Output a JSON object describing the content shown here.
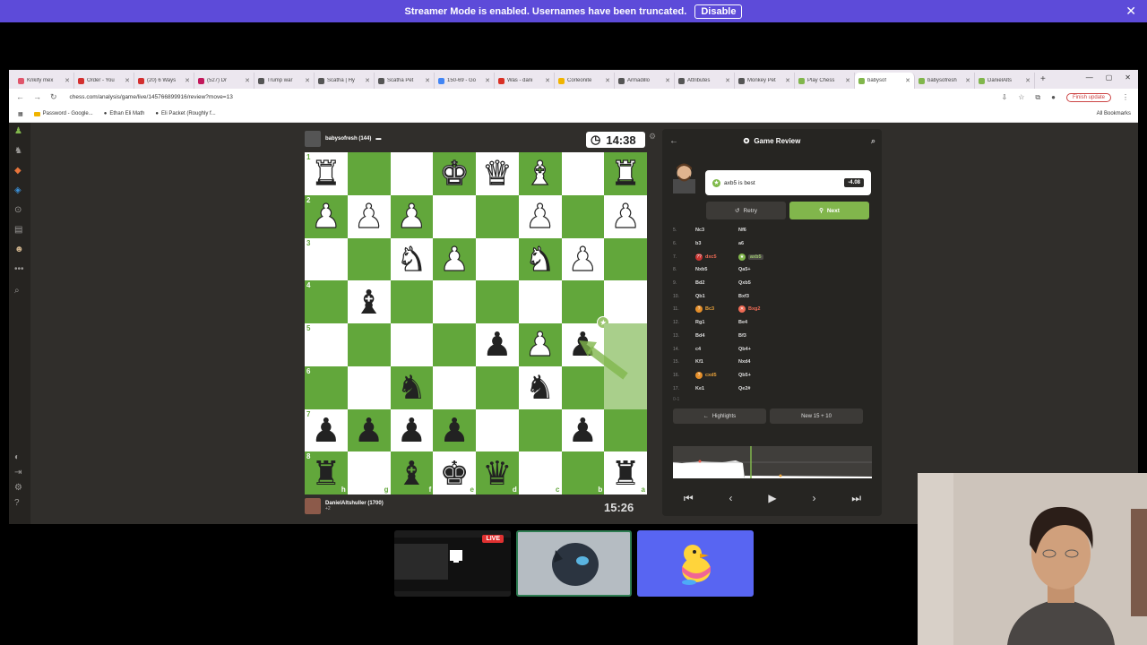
{
  "banner": {
    "message": "Streamer Mode is enabled. Usernames have been truncated.",
    "button": "Disable"
  },
  "browser": {
    "tabs": [
      {
        "label": "Krikify mex",
        "color": "#e0556b"
      },
      {
        "label": "Order - You",
        "color": "#d32f2f"
      },
      {
        "label": "(20) 6 Ways",
        "color": "#d32f2f"
      },
      {
        "label": "(527) Dr",
        "color": "#c2185b"
      },
      {
        "label": "Trump war",
        "color": "#555555"
      },
      {
        "label": "Scatha | Hy",
        "color": "#555555"
      },
      {
        "label": "Scatha Pet",
        "color": "#555555"
      },
      {
        "label": "150-69 - Go",
        "color": "#4285f4"
      },
      {
        "label": "Was - dani",
        "color": "#d93025"
      },
      {
        "label": "Corleonite",
        "color": "#f0b400"
      },
      {
        "label": "Armadillo",
        "color": "#555555"
      },
      {
        "label": "Attributes",
        "color": "#555555"
      },
      {
        "label": "Monkey Pet",
        "color": "#555555"
      },
      {
        "label": "Play Chess",
        "color": "#81b64c"
      },
      {
        "label": "babysof",
        "color": "#81b64c"
      },
      {
        "label": "babysofresh",
        "color": "#81b64c"
      },
      {
        "label": "DanielAlts",
        "color": "#81b64c"
      }
    ],
    "url": "chess.com/analysis/game/live/145766899916/review?move=13",
    "finish_update": "Finish update",
    "bookmarks": [
      "Password - Google...",
      "Ethan Eli Math",
      "Eli Packet (Roughly f..."
    ],
    "all_bookmarks": "All Bookmarks"
  },
  "game": {
    "top_player": "babysofresh (144)",
    "top_clock": "14:38",
    "bottom_player": "DanielAltshuller (1700)",
    "bottom_sub": "+2",
    "bottom_clock": "15:26",
    "board": [
      [
        "wR",
        "",
        "",
        "wK",
        "wQ",
        "wB",
        "",
        "wR"
      ],
      [
        "wP",
        "wP",
        "wP",
        "",
        "",
        "wP",
        "",
        "wP"
      ],
      [
        "",
        "",
        "wN",
        "wP",
        "",
        "wN",
        "wP",
        ""
      ],
      [
        "",
        "bB",
        "",
        "",
        "",
        "",
        "",
        ""
      ],
      [
        "",
        "",
        "",
        "",
        "bP",
        "wP",
        "bP",
        ""
      ],
      [
        "",
        "",
        "bN",
        "",
        "",
        "bN",
        "",
        ""
      ],
      [
        "bP",
        "bP",
        "bP",
        "bP",
        "",
        "",
        "bP",
        ""
      ],
      [
        "bR",
        "",
        "bB",
        "bK",
        "bQ",
        "",
        "",
        "bR"
      ]
    ],
    "ranks": [
      "1",
      "2",
      "3",
      "4",
      "5",
      "6",
      "7",
      "8"
    ],
    "files": [
      "h",
      "g",
      "f",
      "e",
      "d",
      "c",
      "b",
      "a"
    ]
  },
  "review": {
    "title": "Game Review",
    "best_move": "axb5 is best",
    "eval": "-4.08",
    "retry": "Retry",
    "next": "Next",
    "moves": [
      {
        "n": "5.",
        "w": "Nc3",
        "b": "Nf6",
        "wb": "",
        "bb": ""
      },
      {
        "n": "6.",
        "w": "b3",
        "b": "a6",
        "wb": "",
        "bb": ""
      },
      {
        "n": "7.",
        "w": "dxc5",
        "b": "axb5",
        "wb": "blunder",
        "bb": "best"
      },
      {
        "n": "8.",
        "w": "Nxb5",
        "b": "Qa5+",
        "wb": "",
        "bb": ""
      },
      {
        "n": "9.",
        "w": "Bd2",
        "b": "Qxb5",
        "wb": "",
        "bb": ""
      },
      {
        "n": "10.",
        "w": "Qb1",
        "b": "Bxf3",
        "wb": "",
        "bb": ""
      },
      {
        "n": "11.",
        "w": "Bc3",
        "b": "Bxg2",
        "wb": "mistake",
        "bb": "miss"
      },
      {
        "n": "12.",
        "w": "Rg1",
        "b": "Be4",
        "wb": "",
        "bb": ""
      },
      {
        "n": "13.",
        "w": "Bd4",
        "b": "Bf3",
        "wb": "",
        "bb": ""
      },
      {
        "n": "14.",
        "w": "c4",
        "b": "Qb4+",
        "wb": "",
        "bb": ""
      },
      {
        "n": "15.",
        "w": "Kf1",
        "b": "Nxd4",
        "wb": "",
        "bb": ""
      },
      {
        "n": "16.",
        "w": "cxd5",
        "b": "Qb5+",
        "wb": "mistake",
        "bb": ""
      },
      {
        "n": "17.",
        "w": "Ke1",
        "b": "Qe2#",
        "wb": "",
        "bb": ""
      }
    ],
    "result": "0-1",
    "highlights": "Highlights",
    "new_game": "New 15 + 10"
  },
  "stream": {
    "live": "LIVE"
  }
}
